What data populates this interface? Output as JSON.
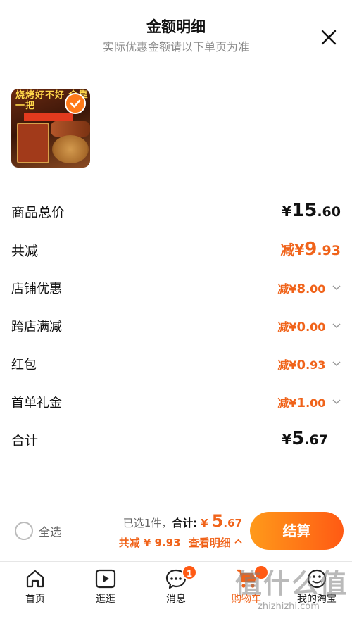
{
  "header": {
    "title": "金额明细",
    "subtitle": "实际优惠金额请以下单页为准"
  },
  "product": {
    "image_banner": "烧烤好不好 全靠一把",
    "selected": true
  },
  "rows": [
    {
      "label": "商品总价",
      "prefix": "",
      "symbol": "¥",
      "int": "15",
      "dec": ".60"
    },
    {
      "label": "共减",
      "prefix": "减",
      "symbol": "¥",
      "int": "9",
      "dec": ".93"
    },
    {
      "label": "店铺优惠",
      "prefix": "减",
      "symbol": "¥",
      "int": "8",
      "dec": ".00"
    },
    {
      "label": "跨店满减",
      "prefix": "减",
      "symbol": "¥",
      "int": "0",
      "dec": ".00"
    },
    {
      "label": "红包",
      "prefix": "减",
      "symbol": "¥",
      "int": "0",
      "dec": ".93"
    },
    {
      "label": "首单礼金",
      "prefix": "减",
      "symbol": "¥",
      "int": "1",
      "dec": ".00"
    },
    {
      "label": "合计",
      "prefix": "",
      "symbol": "¥",
      "int": "5",
      "dec": ".67"
    }
  ],
  "bottom": {
    "select_all": "全选",
    "selected_count": "已选1件，",
    "total_label": "合计:",
    "total_symbol": "¥",
    "total_int": "5",
    "total_dec": ".67",
    "saved_text": "共减 ¥ 9.93",
    "detail_link": "查看明细",
    "checkout": "结算"
  },
  "tabs": [
    {
      "label": "首页",
      "icon": "home-icon"
    },
    {
      "label": "逛逛",
      "icon": "play-icon"
    },
    {
      "label": "消息",
      "icon": "message-icon",
      "badge": "1"
    },
    {
      "label": "购物车",
      "icon": "cart-icon",
      "active": true
    },
    {
      "label": "我的淘宝",
      "icon": "profile-icon"
    }
  ],
  "watermark": {
    "logo": "值什么值",
    "url": "zhizhizhi.com"
  },
  "colors": {
    "accent": "#f0631a",
    "checkout_start": "#ff9a1a",
    "checkout_end": "#ff5a14"
  }
}
